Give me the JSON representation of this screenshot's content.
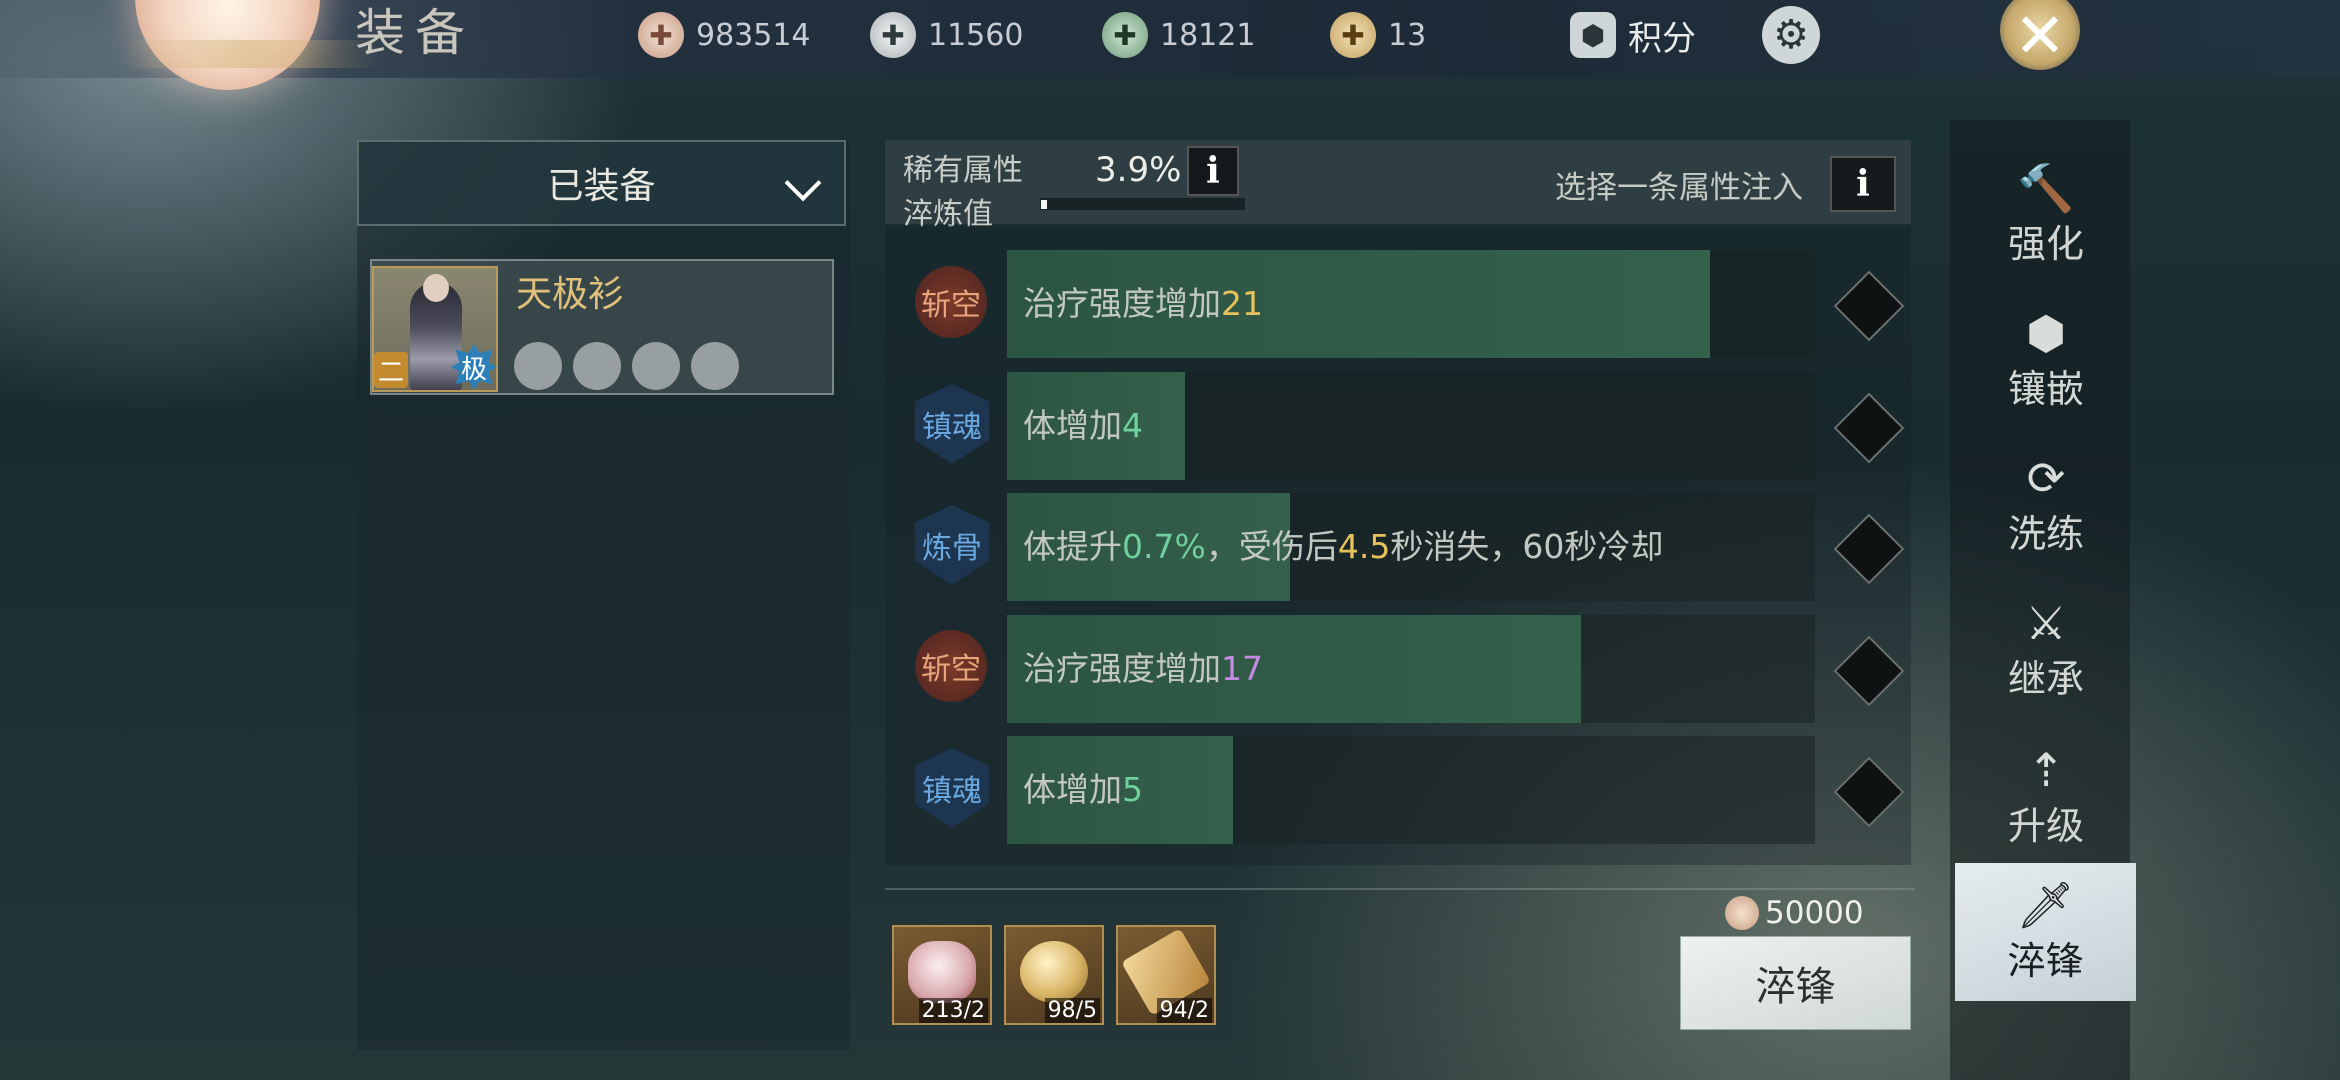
{
  "header": {
    "title": "装备",
    "currencies": [
      {
        "icon": "coin-plus-icon",
        "value": "983514"
      },
      {
        "icon": "silver-ingot-plus-icon",
        "value": "11560"
      },
      {
        "icon": "jade-ticket-plus-icon",
        "value": "18121"
      },
      {
        "icon": "gold-ingot-plus-icon",
        "value": "13"
      }
    ],
    "points_label": "积分"
  },
  "left_panel": {
    "dropdown_label": "已装备",
    "item": {
      "name": "天极衫",
      "grade_badge": "二",
      "quality_badge": "极",
      "slots": 4
    }
  },
  "refine": {
    "rare_label": "稀有属性",
    "refine_value_label": "淬炼值",
    "rare_percent": "3.9%",
    "info_icon": "i",
    "refine_progress": 0.03,
    "select_hint": "选择一条属性注入",
    "attributes": [
      {
        "tag": "斩空",
        "tag_style": "red",
        "text": "治疗强度增加",
        "value": "21",
        "value_color": "#e7c25a",
        "fill": 0.87
      },
      {
        "tag": "镇魂",
        "tag_style": "blue",
        "text": "体增加",
        "value": "4",
        "value_color": "#6fcf9d",
        "fill": 0.22
      },
      {
        "tag": "炼骨",
        "tag_style": "blue",
        "text_parts": [
          "体提升",
          "0.7%",
          "，受伤后",
          "4.5",
          "秒消失，60秒冷却"
        ],
        "fill": 0.35
      },
      {
        "tag": "斩空",
        "tag_style": "red",
        "text": "治疗强度增加",
        "value": "17",
        "value_color": "#c78ae3",
        "fill": 0.71
      },
      {
        "tag": "镇魂",
        "tag_style": "blue",
        "text": "体增加",
        "value": "5",
        "value_color": "#6fcf9d",
        "fill": 0.28
      }
    ],
    "materials": [
      {
        "icon": "pearl-shell-icon",
        "count": "213/2"
      },
      {
        "icon": "gold-orb-icon",
        "count": "98/5"
      },
      {
        "icon": "talisman-icon",
        "count": "94/2"
      }
    ],
    "cost": "50000",
    "action_label": "淬锋"
  },
  "nav": [
    {
      "label": "强化",
      "icon": "hammer-icon"
    },
    {
      "label": "镶嵌",
      "icon": "gem-icon"
    },
    {
      "label": "洗练",
      "icon": "refresh-icon"
    },
    {
      "label": "继承",
      "icon": "inherit-icon"
    },
    {
      "label": "升级",
      "icon": "upgrade-icon"
    },
    {
      "label": "淬锋",
      "icon": "blade-icon",
      "active": true
    }
  ],
  "colors": {
    "accent_gold": "#e3c07a",
    "bar_green": "#35604b",
    "tag_red": "#7c3a2a",
    "tag_blue": "#1e3550"
  }
}
